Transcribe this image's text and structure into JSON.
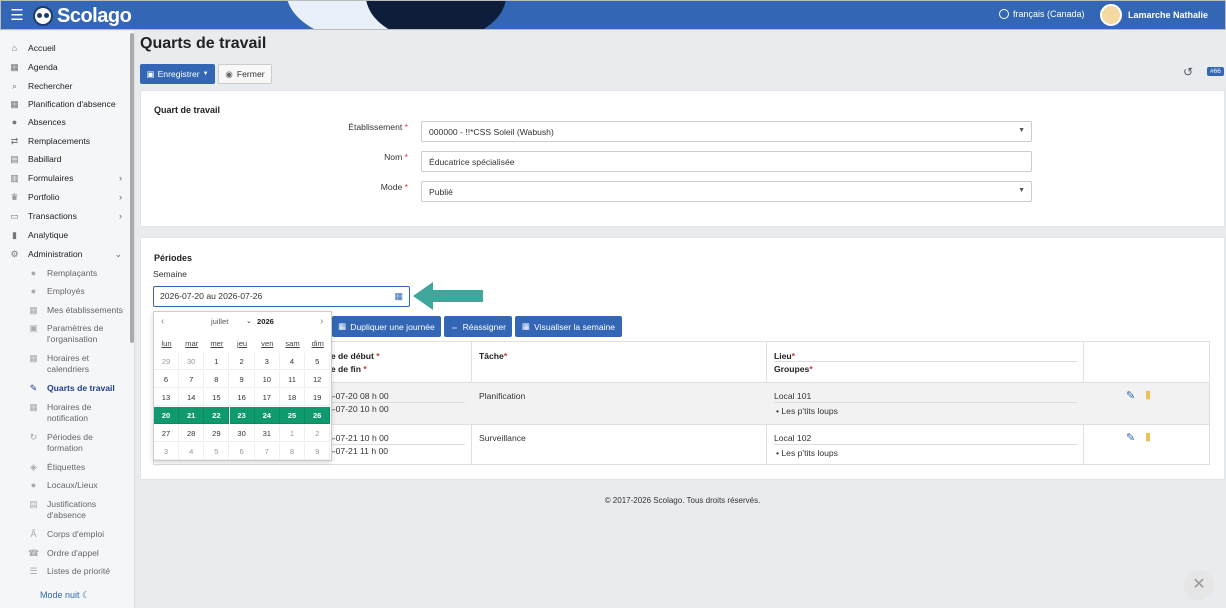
{
  "topbar": {
    "menu_icon": "hamburger-icon",
    "logo_text": "Scolago",
    "language": "français (Canada)",
    "user_name": "Lamarche Nathalie"
  },
  "sidebar": {
    "items": [
      {
        "label": "Accueil",
        "icon": "home-icon"
      },
      {
        "label": "Agenda",
        "icon": "calendar-icon"
      },
      {
        "label": "Rechercher",
        "icon": "search-icon"
      },
      {
        "label": "Planification d'absence",
        "icon": "calendar-icon"
      },
      {
        "label": "Absences",
        "icon": "user-minus-icon"
      },
      {
        "label": "Remplacements",
        "icon": "exchange-icon"
      },
      {
        "label": "Babillard",
        "icon": "board-icon"
      },
      {
        "label": "Formulaires",
        "icon": "form-icon"
      },
      {
        "label": "Portfolio",
        "icon": "trophy-icon"
      },
      {
        "label": "Transactions",
        "icon": "transactions-icon"
      },
      {
        "label": "Analytique",
        "icon": "chart-icon"
      },
      {
        "label": "Administration",
        "icon": "gear-icon"
      }
    ],
    "sub_items": [
      {
        "label": "Remplaçants"
      },
      {
        "label": "Employés"
      },
      {
        "label": "Mes établissements"
      },
      {
        "label": "Paramètres de l'organisation"
      },
      {
        "label": "Horaires et calendriers"
      },
      {
        "label": "Quarts de travail"
      },
      {
        "label": "Horaires de notification"
      },
      {
        "label": "Périodes de formation"
      },
      {
        "label": "Étiquettes"
      },
      {
        "label": "Locaux/Lieux"
      },
      {
        "label": "Justifications d'absence"
      },
      {
        "label": "Corps d'emploi"
      },
      {
        "label": "Ordre d'appel"
      },
      {
        "label": "Listes de priorité"
      }
    ],
    "night_mode": "Mode nuit"
  },
  "page": {
    "title": "Quarts de travail",
    "save_label": "Enregistrer",
    "close_label": "Fermer",
    "badge": "#66"
  },
  "form": {
    "section_title": "Quart de travail",
    "etablissement_label": "Établissement",
    "etablissement_value": "000000 - !!*CSS Soleil (Wabush)",
    "nom_label": "Nom",
    "nom_value": "Éducatrice spécialisée",
    "mode_label": "Mode",
    "mode_value": "Publié"
  },
  "periods": {
    "section_title": "Périodes",
    "week_label": "Semaine",
    "week_value": "2026-07-20 au 2026-07-26",
    "buttons": {
      "duplicate": "Dupliquer une journée",
      "reassign": "Réassigner",
      "view_week": "Visualiser la semaine"
    },
    "headers": {
      "start": "te de début",
      "end": "te de fin",
      "task": "Tâche",
      "place": "Lieu",
      "groups": "Groupes"
    },
    "rows": [
      {
        "start": "6-07-20 08 h 00",
        "end": "6-07-20 10 h 00",
        "task": "Planification",
        "place": "Local 101",
        "group": "Les p'tits loups"
      },
      {
        "start": "6-07-21 10 h 00",
        "end": "6-07-21 11 h 00",
        "task": "Surveillance",
        "place": "Local 102",
        "group": "Les p'tits loups"
      }
    ]
  },
  "calendar": {
    "month": "juillet",
    "year": "2026",
    "dow": [
      "lun",
      "mar",
      "mer",
      "jeu",
      "ven",
      "sam",
      "dim"
    ],
    "weeks": [
      [
        "29",
        "30",
        "1",
        "2",
        "3",
        "4",
        "5"
      ],
      [
        "6",
        "7",
        "8",
        "9",
        "10",
        "11",
        "12"
      ],
      [
        "13",
        "14",
        "15",
        "16",
        "17",
        "18",
        "19"
      ],
      [
        "20",
        "21",
        "22",
        "23",
        "24",
        "25",
        "26"
      ],
      [
        "27",
        "28",
        "29",
        "30",
        "31",
        "1",
        "2"
      ],
      [
        "3",
        "4",
        "5",
        "6",
        "7",
        "8",
        "9"
      ]
    ],
    "selected_week_index": 3,
    "accent_color": "#0e9a6e"
  },
  "footer": "© 2017-2026 Scolago. Tous droits réservés."
}
